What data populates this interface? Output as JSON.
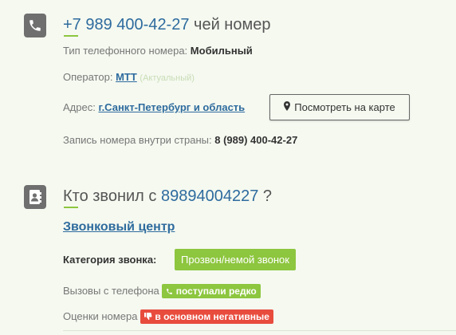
{
  "phone_section": {
    "icon": "phone-icon",
    "number": "+7 989 400-42-27",
    "heading_suffix": "чей номер",
    "type_label": "Тип телефонного номера:",
    "type_value": "Мобильный",
    "operator_label": "Оператор:",
    "operator_value": "МТТ",
    "operator_status": "(Актуальный)",
    "address_label": "Адрес:",
    "address_value": "г.Санкт-Петербург и область",
    "map_button": "Посмотреть на карте",
    "map_icon": "map-marker-icon",
    "domestic_label": "Запись номера внутри страны:",
    "domestic_value": "8 (989) 400-42-27"
  },
  "caller_section": {
    "icon": "address-book-icon",
    "heading_prefix": "Кто звонил с",
    "heading_number": "89894004227",
    "heading_suffix": "?",
    "caller_link": "Звонковый центр",
    "category_label": "Категория звонка:",
    "category_value": "Прозвон/немой звонок",
    "calls_label": "Вызовы с телефона",
    "calls_badge": "поступали редко",
    "ratings_label": "Оценки номера",
    "ratings_badge": "в основном негативные"
  },
  "colors": {
    "accent_green": "#8dc63f",
    "link_blue": "#2e6b9e",
    "negative_red": "#e84c3d",
    "background": "#f5f9f0"
  }
}
